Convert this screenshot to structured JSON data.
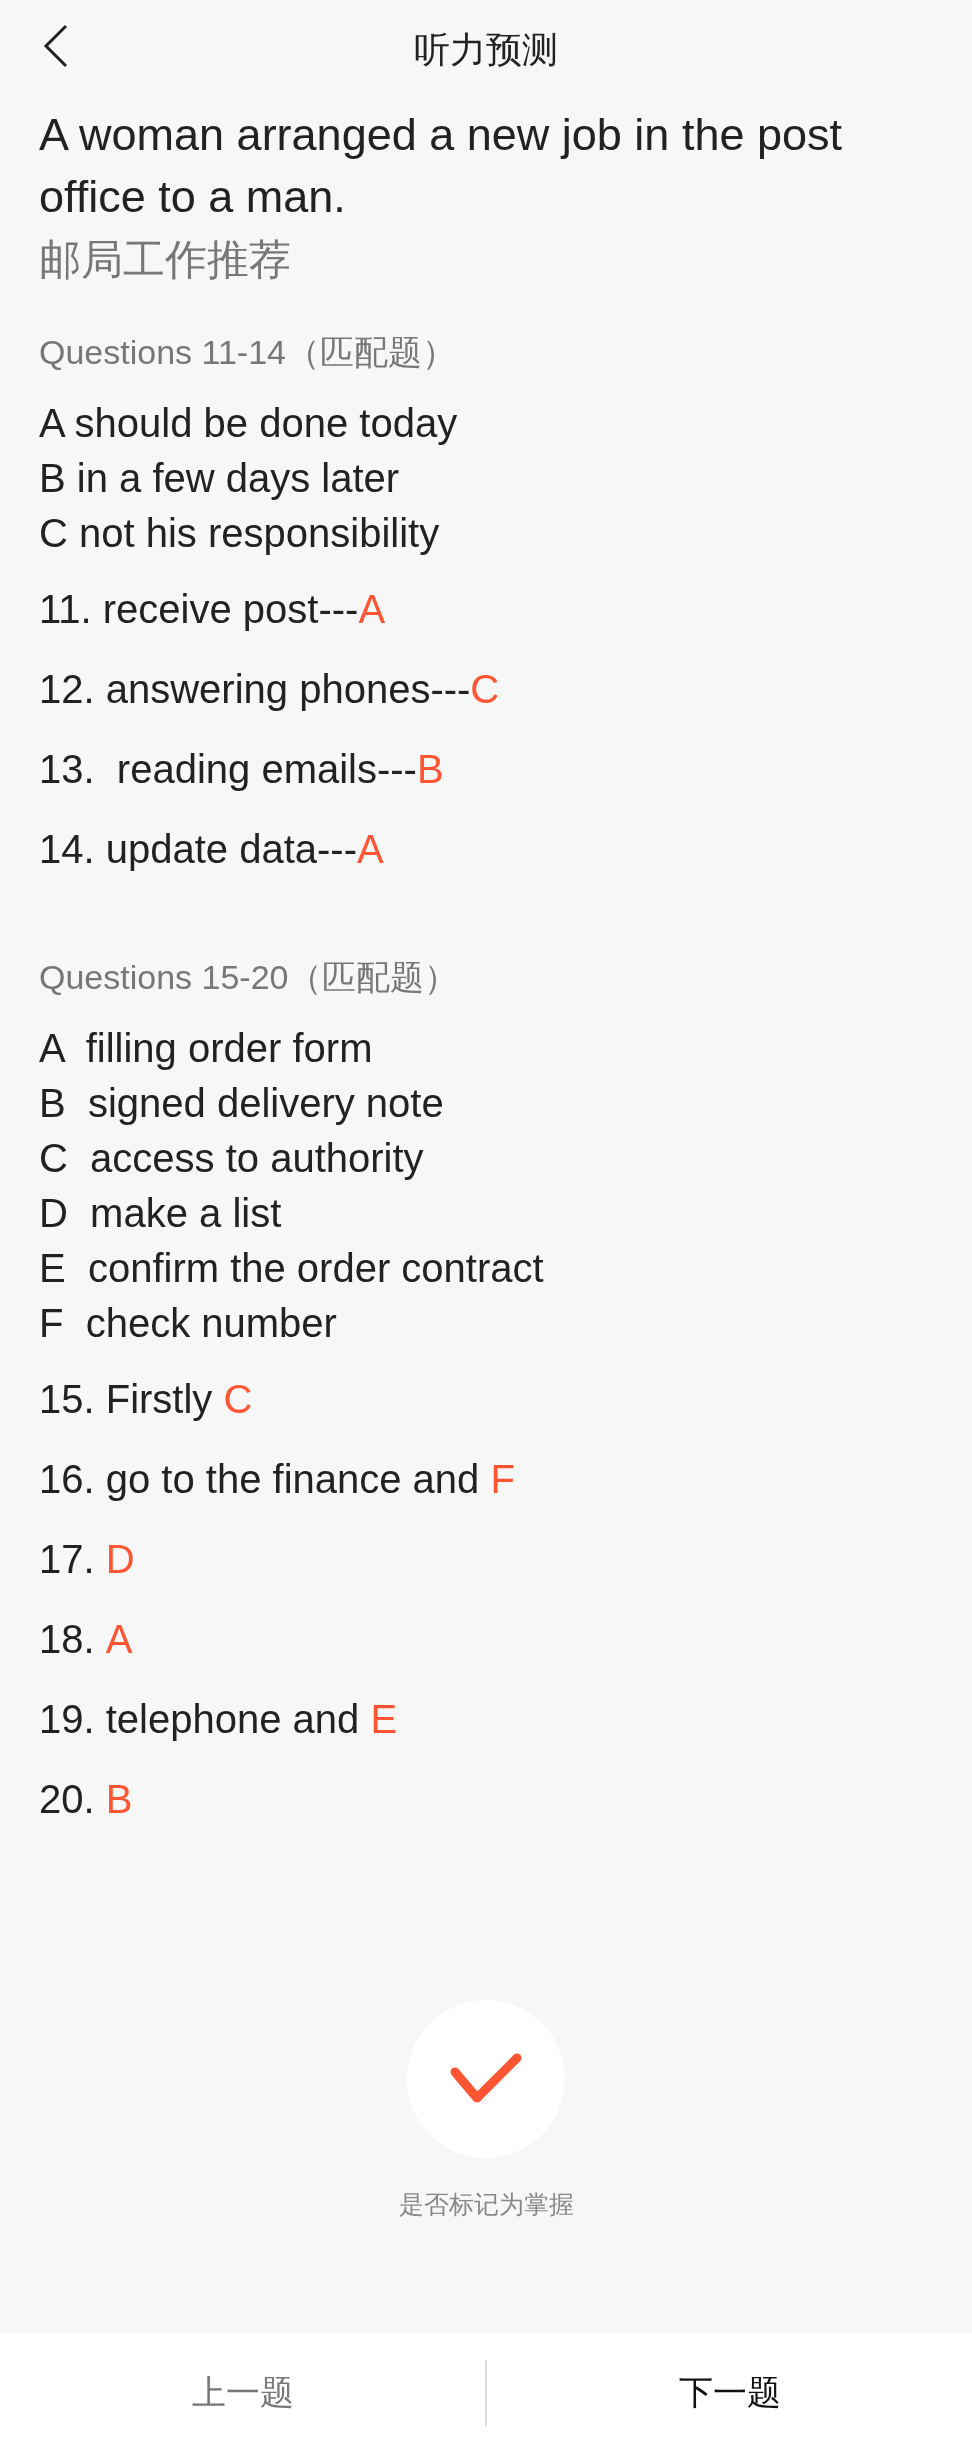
{
  "header": {
    "title": "听力预测"
  },
  "passage": {
    "title": "A woman arranged a new job in the post office to a man.",
    "subtitle": "邮局工作推荐"
  },
  "sections": [
    {
      "heading": "Questions 11-14（匹配题）",
      "options": [
        "A should be done today",
        "B in a few days later",
        "C not his responsibility"
      ],
      "questions": [
        {
          "text": "11. receive post---",
          "answer": "A"
        },
        {
          "text": "12. answering phones---",
          "answer": "C"
        },
        {
          "text": "13.  reading emails---",
          "answer": "B"
        },
        {
          "text": "14. update data---",
          "answer": "A"
        }
      ]
    },
    {
      "heading": "Questions 15-20（匹配题）",
      "options": [
        "A  filling order form",
        "B  signed delivery note",
        "C  access to authority",
        "D  make a list",
        "E  confirm the order contract",
        "F  check number"
      ],
      "questions": [
        {
          "text": "15. Firstly ",
          "answer": "C"
        },
        {
          "text": "16. go to the finance and ",
          "answer": "F"
        },
        {
          "text": "17. ",
          "answer": "D"
        },
        {
          "text": "18. ",
          "answer": "A"
        },
        {
          "text": "19. telephone and ",
          "answer": "E"
        },
        {
          "text": "20. ",
          "answer": "B"
        }
      ]
    }
  ],
  "mastered": {
    "label": "是否标记为掌握"
  },
  "footer": [
    {
      "label": "上一题",
      "disabled": true
    },
    {
      "label": "下一题",
      "disabled": false
    }
  ]
}
